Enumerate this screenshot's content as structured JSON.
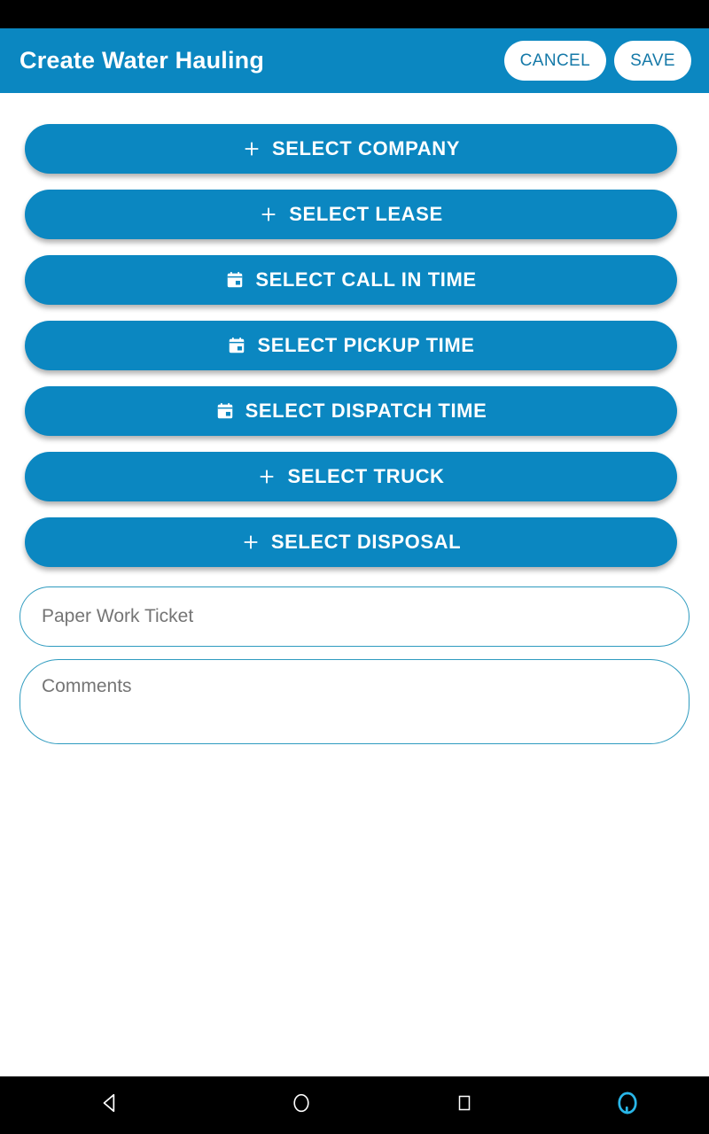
{
  "status_bar": {
    "background": "#000000"
  },
  "app_bar": {
    "title": "Create Water Hauling",
    "background": "#0B87C1",
    "cancel_label": "CANCEL",
    "save_label": "SAVE",
    "action_text_color": "#1579A8"
  },
  "form": {
    "button_color": "#0B87C1",
    "buttons": [
      {
        "label": "SELECT COMPANY",
        "icon": "plus-icon"
      },
      {
        "label": "SELECT LEASE",
        "icon": "plus-icon"
      },
      {
        "label": "SELECT CALL IN TIME",
        "icon": "calendar-icon"
      },
      {
        "label": "SELECT PICKUP TIME",
        "icon": "calendar-icon"
      },
      {
        "label": "SELECT DISPATCH TIME",
        "icon": "calendar-icon"
      },
      {
        "label": "SELECT TRUCK",
        "icon": "plus-icon"
      },
      {
        "label": "SELECT DISPOSAL",
        "icon": "plus-icon"
      }
    ],
    "paper_work_ticket": {
      "value": "",
      "placeholder": "Paper Work Ticket"
    },
    "comments": {
      "value": "",
      "placeholder": "Comments"
    },
    "field_border_color": "#2E9BBF"
  },
  "nav_bar": {
    "background": "#000000",
    "items": [
      {
        "name": "back-icon",
        "glyph": "triangle-left"
      },
      {
        "name": "home-icon",
        "glyph": "circle"
      },
      {
        "name": "recents-icon",
        "glyph": "square"
      },
      {
        "name": "assistant-icon",
        "glyph": "ring",
        "color": "#29B6E8"
      }
    ]
  }
}
